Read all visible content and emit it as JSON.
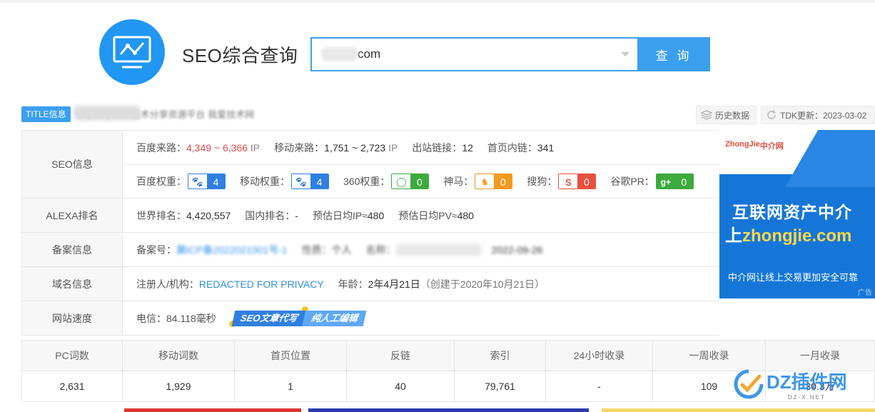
{
  "header": {
    "brand": "SEO综合查询",
    "search_value": "com",
    "search_button": "查 询"
  },
  "title_row": {
    "tag": "TITLE信息",
    "title_text": "专注优化SEO技术分享资源平台 我爱技术网",
    "history_btn": "历史数据",
    "tdk_btn": "TDK更新：2023-03-02"
  },
  "info": {
    "seo": {
      "label": "SEO信息",
      "baidu_label": "百度来路：",
      "baidu_value": "4,349 ~ 6,366",
      "baidu_unit": "IP",
      "mobile_label": "移动来路：",
      "mobile_value": "1,751 ~ 2,723",
      "mobile_unit": "IP",
      "out_label": "出站链接：",
      "out_value": "12",
      "home_label": "首页内链：",
      "home_value": "341",
      "baidu_weight_label": "百度权重：",
      "baidu_weight": "4",
      "mobile_weight_label": "移动权重：",
      "mobile_weight": "4",
      "weight360_label": "360权重：",
      "weight360": "0",
      "shenma_label": "神马：",
      "shenma": "0",
      "sogou_label": "搜狗：",
      "sogou": "0",
      "google_label": "谷歌PR：",
      "google": "0"
    },
    "alexa": {
      "label": "ALEXA排名",
      "world_label": "世界排名：",
      "world": "4,420,557",
      "domestic_label": "国内排名：",
      "domestic": "-",
      "ip_label": "预估日均IP≈",
      "ip": "480",
      "pv_label": "预估日均PV≈",
      "pv": "480"
    },
    "beian": {
      "label": "备案信息",
      "no_label": "备案号：",
      "no_value": "冀ICP备2022021001号-1",
      "nature_label": "性质：",
      "nature_value": "个人",
      "name_label": "名称：",
      "date_value": "2022-09-26"
    },
    "domain": {
      "label": "域名信息",
      "reg_label": "注册人/机构：",
      "reg_value": "REDACTED FOR PRIVACY",
      "age_label": "年龄：",
      "age_value": "2年4月21日",
      "created": "（创建于2020年10月21日）"
    },
    "speed": {
      "label": "网站速度",
      "value": "电信：84.118毫秒",
      "banner1": "SEO文章代写",
      "banner2": "纯人工编辑"
    }
  },
  "ad": {
    "logo": "ZhongJie",
    "logo_sub": "中介网",
    "line1": "互联网资产中介",
    "line2_pre": "上",
    "line2_domain": "zhongjie.com",
    "line3": "中介网让线上交易更加安全可靠",
    "tag": "广告"
  },
  "stats": {
    "headers": [
      "PC词数",
      "移动词数",
      "首页位置",
      "反链",
      "索引",
      "24小时收录",
      "一周收录",
      "一月收录"
    ],
    "values": [
      "2,631",
      "1,929",
      "1",
      "40",
      "79,761",
      "-",
      "109",
      "30.3万"
    ]
  },
  "watermark": {
    "name": "DZ插件网",
    "sub": "DZ-X.NET"
  },
  "colors": {
    "accent": "#3b9ff0",
    "red": "#e04a4a",
    "link": "#2f8fe6"
  }
}
